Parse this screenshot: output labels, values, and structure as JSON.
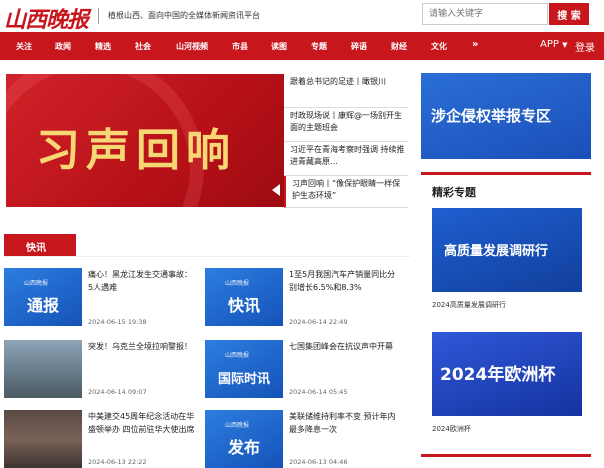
{
  "header": {
    "logo": "山西晚报",
    "slogan": "植根山西、面向中国的全媒体新闻资讯平台",
    "search_placeholder": "请输入关键字",
    "search_button": "搜 索"
  },
  "nav": {
    "items": [
      "关注",
      "政闻",
      "精选",
      "社会",
      "山河视频",
      "市县",
      "读图",
      "专题",
      "碎语",
      "财经",
      "文化"
    ],
    "more": "»",
    "app": "APP",
    "login": "登录"
  },
  "banner": {
    "title": "习声回响"
  },
  "headlines": [
    "跟着总书记的足迹丨瞰银川",
    "时政现场说丨康辉@一场别开生面的主题班会",
    "习近平在青海考察时强调 持续推进青藏高原…",
    "习声回响丨“像保护眼睛一样保护生态环境”"
  ],
  "right": {
    "report_banner": "涉企侵权举报专区",
    "special_title": "精彩专题",
    "specials": [
      {
        "image_text": "高质量发展调研行",
        "caption": "2024高质量发展调研行"
      },
      {
        "image_text": "2024年欧洲杯",
        "caption": "2024欧洲杯"
      }
    ]
  },
  "section": {
    "title": "快讯"
  },
  "news": [
    {
      "thumb_word": "通报",
      "thumb_mark": "山西晚报",
      "title": "痛心！黑龙江发生交通事故：5人遇难",
      "time": "2024-06-15 19:38"
    },
    {
      "thumb_word": "快讯",
      "thumb_mark": "山西晚报",
      "title": "1至5月我国汽车产销量同比分别增长6.5%和8.3%",
      "time": "2024-06-14 22:49"
    },
    {
      "thumb_word": "",
      "thumb_mark": "",
      "title": "突发！乌克兰全境拉响警报！",
      "time": "2024-06-14 09:07"
    },
    {
      "thumb_word": "国际时讯",
      "thumb_mark": "山西晚报",
      "title": "七国集团峰会在抗议声中开幕",
      "time": "2024-06-14 05:45"
    },
    {
      "thumb_word": "",
      "thumb_mark": "",
      "title": "中美建交45周年纪念活动在华盛顿举办 四位前驻华大使出席",
      "time": "2024-06-13 22:22"
    },
    {
      "thumb_word": "发布",
      "thumb_mark": "山西晚报",
      "title": "美联储维持利率不变 预计年内最多降息一次",
      "time": "2024-06-13 04:46"
    }
  ]
}
